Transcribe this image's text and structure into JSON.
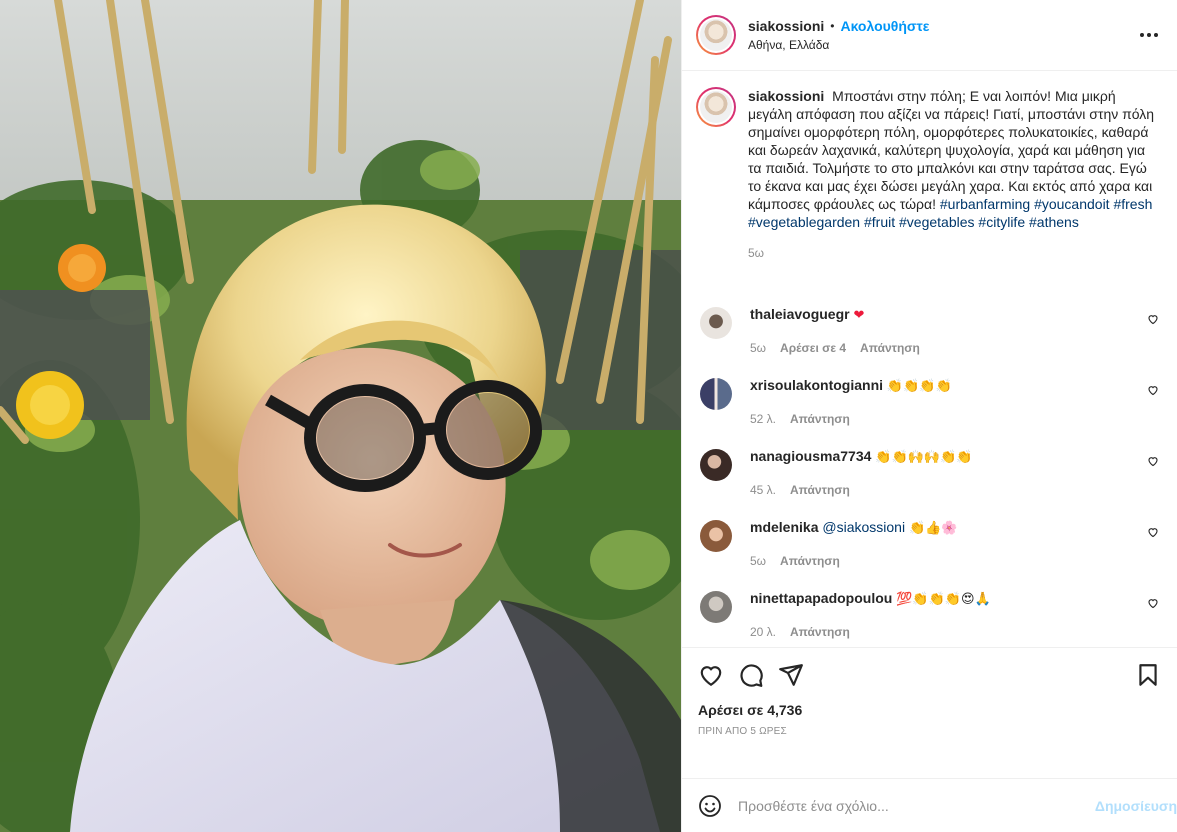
{
  "header": {
    "username": "siakossioni",
    "dot": "•",
    "follow_label": "Ακολουθήστε",
    "location": "Αθήνα, Ελλάδα"
  },
  "caption": {
    "username": "siakossioni",
    "text": "Μποστάνι στην πόλη; Ε ναι λοιπόν! Μια μικρή μεγάλη απόφαση που αξίζει να πάρεις! Γιατί, μποστάνι στην πόλη σημαίνει ομορφότερη πόλη, ομορφότερες πολυκατοικίες, καθαρά και δωρεάν λαχανικά, καλύτερη ψυχολογία, χαρά και μάθηση για τα παιδιά. Τολμήστε το στο μπαλκόνι και στην ταράτσα σας. Εγώ το έκανα και μας έχει δώσει μεγάλη χαρα. Και εκτός από χαρα και κάμποσες φράουλες ως τώρα!",
    "hashtags": [
      "#urbanfarming",
      "#youcandoit",
      "#fresh",
      "#vegetablegarden",
      "#fruit",
      "#vegetables",
      "#citylife",
      "#athens"
    ],
    "time": "5ω"
  },
  "comments": [
    {
      "username": "thaleiavoguegr",
      "text": "",
      "emoji": "❤",
      "time": "5ω",
      "likes": "Αρέσει σε 4",
      "reply": "Απάντηση"
    },
    {
      "username": "xrisoulakontogianni",
      "text": "",
      "emoji": "👏👏👏👏",
      "time": "52 λ.",
      "likes": "",
      "reply": "Απάντηση"
    },
    {
      "username": "nanagiousma7734",
      "text": "",
      "emoji": "👏👏🙌🙌👏👏",
      "time": "45 λ.",
      "likes": "",
      "reply": "Απάντηση"
    },
    {
      "username": "mdelenika",
      "mention": "@siakossioni",
      "emoji": "👏👍🌸",
      "time": "5ω",
      "likes": "",
      "reply": "Απάντηση"
    },
    {
      "username": "ninettapapadopoulou",
      "text": "",
      "emoji": "💯👏👏👏😍🙏",
      "time": "20 λ.",
      "likes": "",
      "reply": "Απάντηση"
    }
  ],
  "actions": {
    "likes_label": "Αρέσει σε 4,736",
    "post_time": "ΠΡΙΝ ΑΠΟ 5 ΩΡΕΣ"
  },
  "add_comment": {
    "placeholder": "Προσθέστε ένα σχόλιο...",
    "publish_label": "Δημοσίευση"
  },
  "icons": {
    "like": "heart-icon",
    "comment": "comment-bubble-icon",
    "share": "paper-plane-icon",
    "save": "bookmark-icon",
    "more": "ellipsis-icon",
    "emoji": "smiley-icon"
  },
  "colors": {
    "accent": "#0095f6",
    "hashtag": "#00376b",
    "muted": "#8e8e8e",
    "publish_disabled": "#b2dffc"
  }
}
